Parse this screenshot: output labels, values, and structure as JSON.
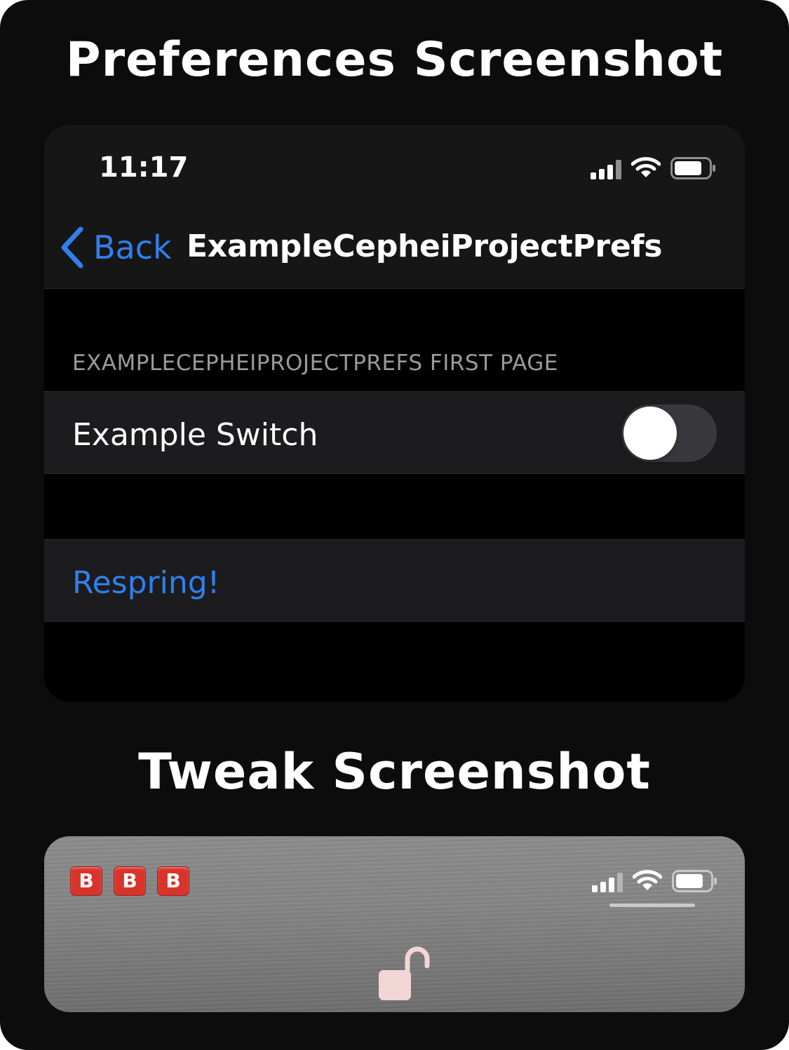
{
  "headings": {
    "preferences": "Preferences Screenshot",
    "tweak": "Tweak Screenshot"
  },
  "prefs": {
    "status_bar": {
      "time": "11:17"
    },
    "nav": {
      "back_label": "Back",
      "title": "ExampleCepheiProjectPrefs"
    },
    "section_header": "EXAMPLECEPHEIPROJECTPREFS FIRST PAGE",
    "switch_cell": {
      "label": "Example Switch",
      "on": false
    },
    "respring_label": "Respring!"
  },
  "tweak": {
    "badges": [
      "B",
      "B",
      "B"
    ],
    "icons": [
      "signal-icon",
      "wifi-icon",
      "battery-icon",
      "unlock-icon"
    ]
  },
  "colors": {
    "accent": "#2f80ed",
    "badge_red": "#d8342c",
    "lock_pink": "#f2d6d6"
  }
}
